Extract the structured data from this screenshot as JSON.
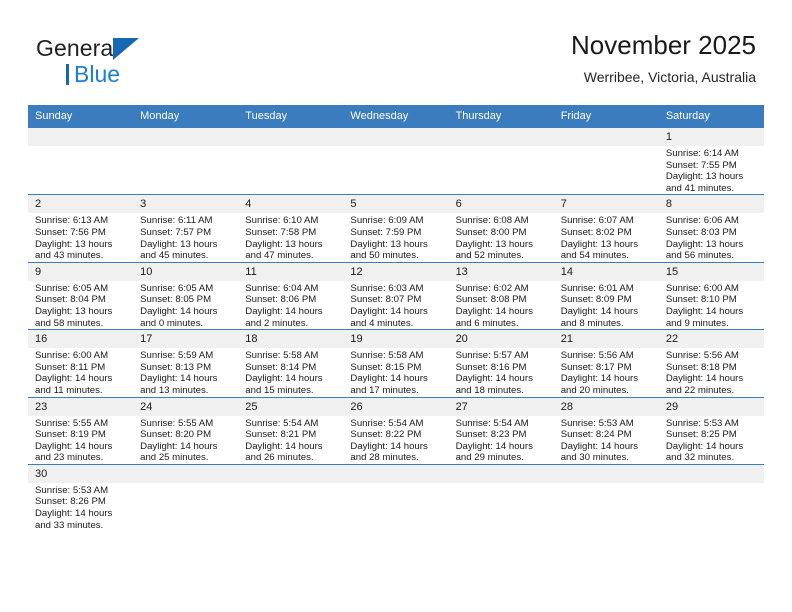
{
  "brand": {
    "line1": "General",
    "line2": "Blue",
    "triangle_icon": "brand-triangle-icon",
    "accent_color": "#1668b3",
    "blue_text_color": "#1b7fd4"
  },
  "header": {
    "title": "November 2025",
    "location": "Werribee, Victoria, Australia"
  },
  "theme": {
    "header_row_bg": "#3a7cbe",
    "daynum_bg": "#f0f0f0",
    "grid_line": "#3a7cbe"
  },
  "weekdays": [
    "Sunday",
    "Monday",
    "Tuesday",
    "Wednesday",
    "Thursday",
    "Friday",
    "Saturday"
  ],
  "labels": {
    "sunrise": "Sunrise:",
    "sunset": "Sunset:",
    "daylight": "Daylight:"
  },
  "weeks": [
    [
      {
        "day": "",
        "blank": true
      },
      {
        "day": "",
        "blank": true
      },
      {
        "day": "",
        "blank": true
      },
      {
        "day": "",
        "blank": true
      },
      {
        "day": "",
        "blank": true
      },
      {
        "day": "",
        "blank": true
      },
      {
        "day": "1",
        "sunrise": "Sunrise: 6:14 AM",
        "sunset": "Sunset: 7:55 PM",
        "daylight1": "Daylight: 13 hours",
        "daylight2": "and 41 minutes."
      }
    ],
    [
      {
        "day": "2",
        "sunrise": "Sunrise: 6:13 AM",
        "sunset": "Sunset: 7:56 PM",
        "daylight1": "Daylight: 13 hours",
        "daylight2": "and 43 minutes."
      },
      {
        "day": "3",
        "sunrise": "Sunrise: 6:11 AM",
        "sunset": "Sunset: 7:57 PM",
        "daylight1": "Daylight: 13 hours",
        "daylight2": "and 45 minutes."
      },
      {
        "day": "4",
        "sunrise": "Sunrise: 6:10 AM",
        "sunset": "Sunset: 7:58 PM",
        "daylight1": "Daylight: 13 hours",
        "daylight2": "and 47 minutes."
      },
      {
        "day": "5",
        "sunrise": "Sunrise: 6:09 AM",
        "sunset": "Sunset: 7:59 PM",
        "daylight1": "Daylight: 13 hours",
        "daylight2": "and 50 minutes."
      },
      {
        "day": "6",
        "sunrise": "Sunrise: 6:08 AM",
        "sunset": "Sunset: 8:00 PM",
        "daylight1": "Daylight: 13 hours",
        "daylight2": "and 52 minutes."
      },
      {
        "day": "7",
        "sunrise": "Sunrise: 6:07 AM",
        "sunset": "Sunset: 8:02 PM",
        "daylight1": "Daylight: 13 hours",
        "daylight2": "and 54 minutes."
      },
      {
        "day": "8",
        "sunrise": "Sunrise: 6:06 AM",
        "sunset": "Sunset: 8:03 PM",
        "daylight1": "Daylight: 13 hours",
        "daylight2": "and 56 minutes."
      }
    ],
    [
      {
        "day": "9",
        "sunrise": "Sunrise: 6:05 AM",
        "sunset": "Sunset: 8:04 PM",
        "daylight1": "Daylight: 13 hours",
        "daylight2": "and 58 minutes."
      },
      {
        "day": "10",
        "sunrise": "Sunrise: 6:05 AM",
        "sunset": "Sunset: 8:05 PM",
        "daylight1": "Daylight: 14 hours",
        "daylight2": "and 0 minutes."
      },
      {
        "day": "11",
        "sunrise": "Sunrise: 6:04 AM",
        "sunset": "Sunset: 8:06 PM",
        "daylight1": "Daylight: 14 hours",
        "daylight2": "and 2 minutes."
      },
      {
        "day": "12",
        "sunrise": "Sunrise: 6:03 AM",
        "sunset": "Sunset: 8:07 PM",
        "daylight1": "Daylight: 14 hours",
        "daylight2": "and 4 minutes."
      },
      {
        "day": "13",
        "sunrise": "Sunrise: 6:02 AM",
        "sunset": "Sunset: 8:08 PM",
        "daylight1": "Daylight: 14 hours",
        "daylight2": "and 6 minutes."
      },
      {
        "day": "14",
        "sunrise": "Sunrise: 6:01 AM",
        "sunset": "Sunset: 8:09 PM",
        "daylight1": "Daylight: 14 hours",
        "daylight2": "and 8 minutes."
      },
      {
        "day": "15",
        "sunrise": "Sunrise: 6:00 AM",
        "sunset": "Sunset: 8:10 PM",
        "daylight1": "Daylight: 14 hours",
        "daylight2": "and 9 minutes."
      }
    ],
    [
      {
        "day": "16",
        "sunrise": "Sunrise: 6:00 AM",
        "sunset": "Sunset: 8:11 PM",
        "daylight1": "Daylight: 14 hours",
        "daylight2": "and 11 minutes."
      },
      {
        "day": "17",
        "sunrise": "Sunrise: 5:59 AM",
        "sunset": "Sunset: 8:13 PM",
        "daylight1": "Daylight: 14 hours",
        "daylight2": "and 13 minutes."
      },
      {
        "day": "18",
        "sunrise": "Sunrise: 5:58 AM",
        "sunset": "Sunset: 8:14 PM",
        "daylight1": "Daylight: 14 hours",
        "daylight2": "and 15 minutes."
      },
      {
        "day": "19",
        "sunrise": "Sunrise: 5:58 AM",
        "sunset": "Sunset: 8:15 PM",
        "daylight1": "Daylight: 14 hours",
        "daylight2": "and 17 minutes."
      },
      {
        "day": "20",
        "sunrise": "Sunrise: 5:57 AM",
        "sunset": "Sunset: 8:16 PM",
        "daylight1": "Daylight: 14 hours",
        "daylight2": "and 18 minutes."
      },
      {
        "day": "21",
        "sunrise": "Sunrise: 5:56 AM",
        "sunset": "Sunset: 8:17 PM",
        "daylight1": "Daylight: 14 hours",
        "daylight2": "and 20 minutes."
      },
      {
        "day": "22",
        "sunrise": "Sunrise: 5:56 AM",
        "sunset": "Sunset: 8:18 PM",
        "daylight1": "Daylight: 14 hours",
        "daylight2": "and 22 minutes."
      }
    ],
    [
      {
        "day": "23",
        "sunrise": "Sunrise: 5:55 AM",
        "sunset": "Sunset: 8:19 PM",
        "daylight1": "Daylight: 14 hours",
        "daylight2": "and 23 minutes."
      },
      {
        "day": "24",
        "sunrise": "Sunrise: 5:55 AM",
        "sunset": "Sunset: 8:20 PM",
        "daylight1": "Daylight: 14 hours",
        "daylight2": "and 25 minutes."
      },
      {
        "day": "25",
        "sunrise": "Sunrise: 5:54 AM",
        "sunset": "Sunset: 8:21 PM",
        "daylight1": "Daylight: 14 hours",
        "daylight2": "and 26 minutes."
      },
      {
        "day": "26",
        "sunrise": "Sunrise: 5:54 AM",
        "sunset": "Sunset: 8:22 PM",
        "daylight1": "Daylight: 14 hours",
        "daylight2": "and 28 minutes."
      },
      {
        "day": "27",
        "sunrise": "Sunrise: 5:54 AM",
        "sunset": "Sunset: 8:23 PM",
        "daylight1": "Daylight: 14 hours",
        "daylight2": "and 29 minutes."
      },
      {
        "day": "28",
        "sunrise": "Sunrise: 5:53 AM",
        "sunset": "Sunset: 8:24 PM",
        "daylight1": "Daylight: 14 hours",
        "daylight2": "and 30 minutes."
      },
      {
        "day": "29",
        "sunrise": "Sunrise: 5:53 AM",
        "sunset": "Sunset: 8:25 PM",
        "daylight1": "Daylight: 14 hours",
        "daylight2": "and 32 minutes."
      }
    ],
    [
      {
        "day": "30",
        "sunrise": "Sunrise: 5:53 AM",
        "sunset": "Sunset: 8:26 PM",
        "daylight1": "Daylight: 14 hours",
        "daylight2": "and 33 minutes."
      },
      {
        "day": "",
        "blank": true
      },
      {
        "day": "",
        "blank": true
      },
      {
        "day": "",
        "blank": true
      },
      {
        "day": "",
        "blank": true
      },
      {
        "day": "",
        "blank": true
      },
      {
        "day": "",
        "blank": true
      }
    ]
  ]
}
